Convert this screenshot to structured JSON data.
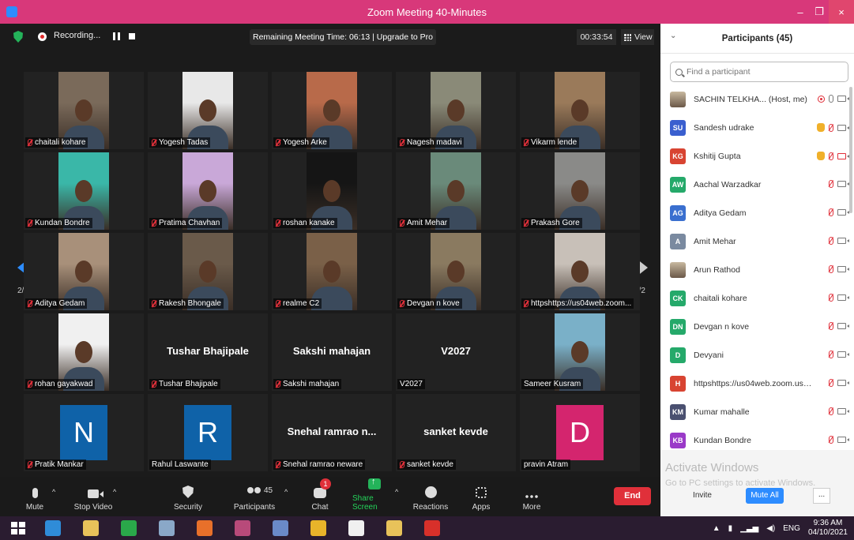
{
  "window": {
    "title": "Zoom Meeting 40-Minutes",
    "min": "–",
    "max": "❐",
    "close": "×"
  },
  "topbar": {
    "recording": "Recording...",
    "remaining": "Remaining Meeting Time: 06:13 | Upgrade to Pro",
    "timer": "00:33:54",
    "view": "View"
  },
  "pager": {
    "left_page": "2/2",
    "right_page": "2/2"
  },
  "tiles": [
    {
      "name": "chaitali kohare",
      "type": "video",
      "bg": "#7a6a5a"
    },
    {
      "name": "Yogesh Tadas",
      "type": "video",
      "bg": "#e8e8e8"
    },
    {
      "name": "Yogesh Arke",
      "type": "video",
      "bg": "#b86a4a"
    },
    {
      "name": "Nagesh madavi",
      "type": "video",
      "bg": "#8a8a78"
    },
    {
      "name": "Vikarm lende",
      "type": "video",
      "bg": "#9a7a5a"
    },
    {
      "name": "Kundan Bondre",
      "type": "video",
      "bg": "#3ab7a8"
    },
    {
      "name": "Pratima Chavhan",
      "type": "video",
      "bg": "#c9a8d8"
    },
    {
      "name": "roshan kanake",
      "type": "video",
      "bg": "#151515"
    },
    {
      "name": "Amit Mehar",
      "type": "video",
      "bg": "#6a8a7a"
    },
    {
      "name": "Prakash Gore",
      "type": "video",
      "bg": "#8a8a88"
    },
    {
      "name": "Aditya Gedam",
      "type": "video",
      "bg": "#a8907a"
    },
    {
      "name": "Rakesh Bhongale",
      "type": "video",
      "bg": "#6a5a4a"
    },
    {
      "name": "realme C2",
      "type": "video",
      "bg": "#7a6048"
    },
    {
      "name": "Devgan n kove",
      "type": "video",
      "bg": "#8a7a60"
    },
    {
      "name": "httpshttps://us04web.zoom...",
      "type": "video",
      "bg": "#c8c0b8"
    },
    {
      "name": "rohan gayakwad",
      "type": "video",
      "bg": "#f0f0f0"
    },
    {
      "name": "Tushar Bhajipale",
      "type": "text",
      "big": "Tushar Bhajipale"
    },
    {
      "name": "Sakshi mahajan",
      "type": "text",
      "big": "Sakshi mahajan"
    },
    {
      "name": "V2027",
      "type": "text",
      "big": "V2027",
      "unmuted": true
    },
    {
      "name": "Sameer Kusram",
      "type": "video",
      "bg": "#7ab0c8",
      "unmuted": true
    },
    {
      "name": "Pratik Mankar",
      "type": "avatar",
      "letter": "N",
      "color": "#0f62a8"
    },
    {
      "name": "Rahul Laswante",
      "type": "avatar",
      "letter": "R",
      "color": "#0f62a8",
      "unmuted": true
    },
    {
      "name": "Snehal ramrao neware",
      "type": "text",
      "big": "Snehal ramrao n..."
    },
    {
      "name": "sanket kevde",
      "type": "text",
      "big": "sanket kevde"
    },
    {
      "name": "pravin Atram",
      "type": "avatar",
      "letter": "D",
      "color": "#d4256e",
      "unmuted": true
    }
  ],
  "toolbar": {
    "mute": "Mute",
    "stop_video": "Stop Video",
    "security": "Security",
    "participants": "Participants",
    "participants_count": "45",
    "chat": "Chat",
    "chat_badge": "1",
    "share_screen": "Share Screen",
    "reactions": "Reactions",
    "apps": "Apps",
    "more": "More",
    "end": "End"
  },
  "panel": {
    "title": "Participants (45)",
    "search_placeholder": "Find a participant",
    "participants": [
      {
        "initials": "",
        "name": "SACHIN TELKHA... (Host, me)",
        "color": "",
        "photo": true,
        "hand": false,
        "mic": "on",
        "cam": "on",
        "rec": true
      },
      {
        "initials": "SU",
        "name": "Sandesh udrake",
        "color": "#3a5fcf",
        "hand": true,
        "mic": "muted",
        "cam": "on"
      },
      {
        "initials": "KG",
        "name": "Kshitij Gupta",
        "color": "#d84432",
        "hand": true,
        "mic": "muted",
        "cam": "off"
      },
      {
        "initials": "AW",
        "name": "Aachal Warzadkar",
        "color": "#25a96a",
        "mic": "muted",
        "cam": "on"
      },
      {
        "initials": "AG",
        "name": "Aditya Gedam",
        "color": "#3a6fcf",
        "mic": "muted",
        "cam": "on"
      },
      {
        "initials": "A",
        "name": "Amit Mehar",
        "color": "#7a8aa0",
        "mic": "muted",
        "cam": "on"
      },
      {
        "initials": "",
        "name": "Arun Rathod",
        "photo": true,
        "mic": "muted",
        "cam": "on"
      },
      {
        "initials": "CK",
        "name": "chaitali kohare",
        "color": "#25a96a",
        "mic": "muted",
        "cam": "on"
      },
      {
        "initials": "DN",
        "name": "Devgan n kove",
        "color": "#25a96a",
        "mic": "muted",
        "cam": "on"
      },
      {
        "initials": "D",
        "name": "Devyani",
        "color": "#25a96a",
        "mic": "muted",
        "cam": "on"
      },
      {
        "initials": "H",
        "name": "httpshttps://us04web.zoom.us/j...",
        "color": "#d84432",
        "mic": "muted",
        "cam": "on"
      },
      {
        "initials": "KM",
        "name": "Kumar mahalle",
        "color": "#4a5070",
        "mic": "muted",
        "cam": "on"
      },
      {
        "initials": "KB",
        "name": "Kundan Bondre",
        "color": "#9a3ac8",
        "mic": "muted",
        "cam": "on"
      }
    ],
    "watermark_title": "Activate Windows",
    "watermark_sub": "Go to PC settings to activate Windows.",
    "invite": "Invite",
    "mute_all": "Mute All",
    "more": "..."
  },
  "taskbar": {
    "apps": [
      {
        "name": "ie-icon",
        "color": "#2f8cd8"
      },
      {
        "name": "file-explorer-icon",
        "color": "#e8c25a"
      },
      {
        "name": "store-icon",
        "color": "#2aa84a"
      },
      {
        "name": "calculator-icon",
        "color": "#8aa8c8"
      },
      {
        "name": "firefox-icon",
        "color": "#e8702a"
      },
      {
        "name": "snipping-tool-icon",
        "color": "#b84a7a"
      },
      {
        "name": "notes-icon",
        "color": "#6a8ac8"
      },
      {
        "name": "chrome-icon",
        "color": "#e8b42a"
      },
      {
        "name": "document-icon",
        "color": "#f0f0f0"
      },
      {
        "name": "folder-icon",
        "color": "#e8c25a"
      },
      {
        "name": "pdf-icon",
        "color": "#d8302a"
      }
    ],
    "lang": "ENG",
    "time": "9:36 AM",
    "date": "04/10/2021"
  }
}
